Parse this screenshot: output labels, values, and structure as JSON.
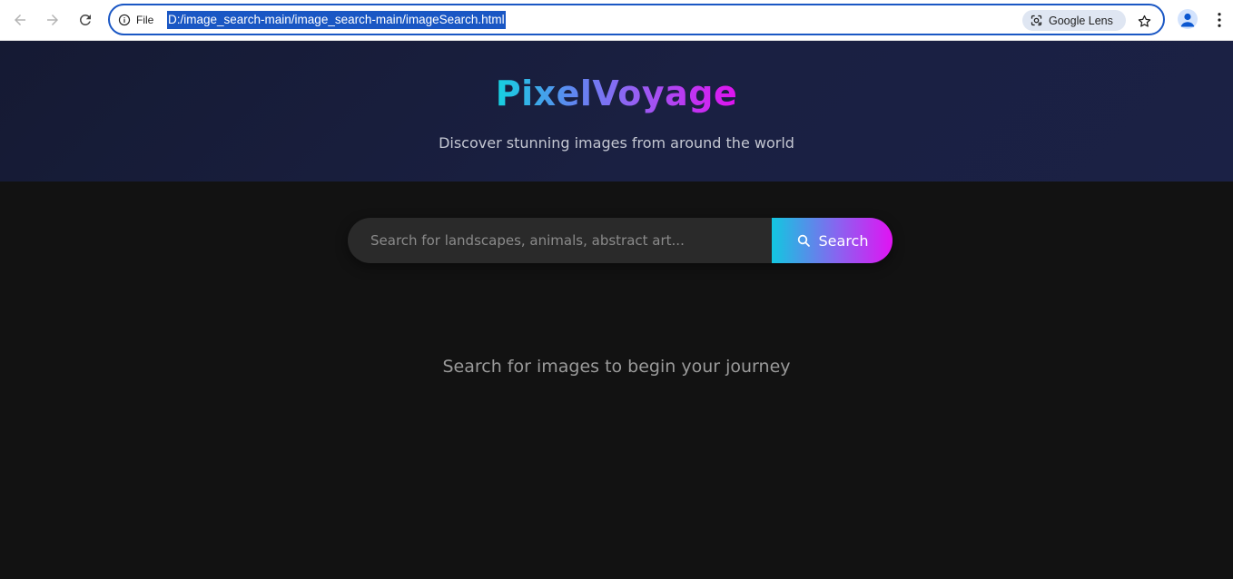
{
  "browser": {
    "site_info_label": "File",
    "url": "D:/image_search-main/image_search-main/imageSearch.html",
    "lens_label": "Google Lens"
  },
  "header": {
    "logo": "PixelVoyage",
    "tagline": "Discover stunning images from around the world"
  },
  "search": {
    "placeholder": "Search for landscapes, animals, abstract art...",
    "value": "",
    "button_label": "Search"
  },
  "results": {
    "empty_message": "Search for images to begin your journey"
  },
  "colors": {
    "accent_start": "#14d2e0",
    "accent_end": "#e012ef",
    "page_background": "#121212",
    "header_background": "#1a2042"
  },
  "icons": {
    "back": "arrow-left-icon",
    "forward": "arrow-right-icon",
    "reload": "reload-icon",
    "site_info": "info-icon",
    "lens": "google-lens-icon",
    "bookmark": "star-icon",
    "profile": "profile-icon",
    "menu": "kebab-menu-icon",
    "search": "search-icon"
  }
}
